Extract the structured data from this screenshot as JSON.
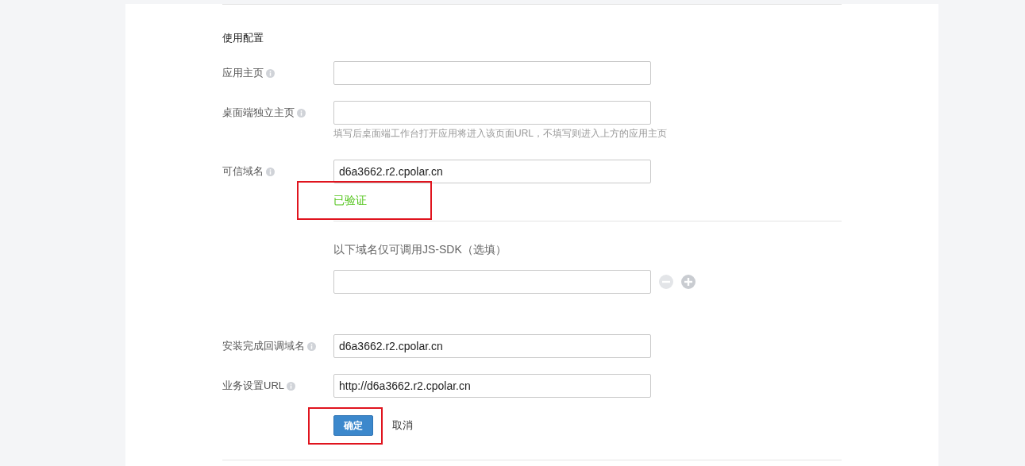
{
  "section_title": "使用配置",
  "fields": [
    {
      "label": "应用主页"
    },
    {
      "label": "桌面端独立主页",
      "hint": "填写后桌面端工作台打开应用将进入该页面URL，不填写则进入上方的应用主页"
    },
    {
      "label": "可信域名",
      "value": "d6a3662.r2.cpolar.cn",
      "status": {
        "text": "已验证",
        "highlighted": true
      }
    }
  ],
  "jssdk": {
    "label": "以下域名仅可调用JS-SDK（选填）",
    "remove_disabled": true
  },
  "fields2": [
    {
      "label": "安装完成回调域名",
      "value": "d6a3662.r2.cpolar.cn"
    },
    {
      "label": "业务设置URL",
      "value": "http://d6a3662.r2.cpolar.cn"
    }
  ],
  "buttons": {
    "confirm": {
      "label": "确定",
      "highlighted": true
    },
    "cancel": {
      "label": "取消"
    }
  }
}
